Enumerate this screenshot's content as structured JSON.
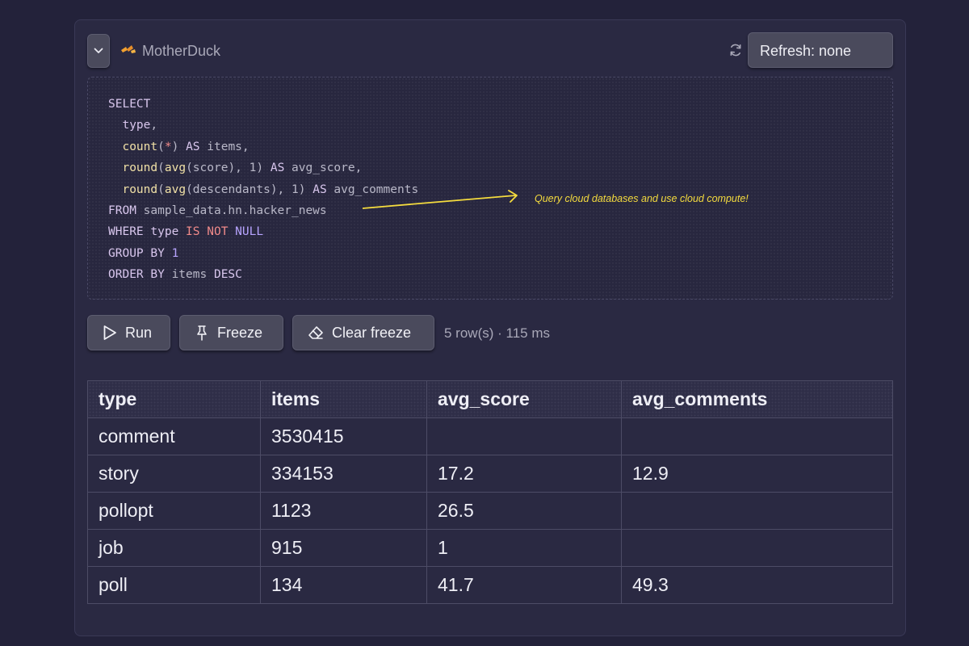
{
  "header": {
    "database_name": "MotherDuck",
    "refresh_label": "Refresh: none"
  },
  "editor": {
    "lines": [
      "SELECT",
      "  type,",
      "  count(*) AS items,",
      "  round(avg(score), 1) AS avg_score,",
      "  round(avg(descendants), 1) AS avg_comments",
      "FROM sample_data.hn.hacker_news",
      "WHERE type IS NOT NULL",
      "GROUP BY 1",
      "ORDER BY items DESC"
    ],
    "annotation": "Query cloud databases and use cloud compute!"
  },
  "actions": {
    "run_label": "Run",
    "freeze_label": "Freeze",
    "clear_freeze_label": "Clear freeze",
    "status": "5 row(s) · 115 ms"
  },
  "results": {
    "columns": [
      "type",
      "items",
      "avg_score",
      "avg_comments"
    ],
    "rows": [
      [
        "comment",
        "3530415",
        "",
        ""
      ],
      [
        "story",
        "334153",
        "17.2",
        "12.9"
      ],
      [
        "pollopt",
        "1123",
        "26.5",
        ""
      ],
      [
        "job",
        "915",
        "1",
        ""
      ],
      [
        "poll",
        "134",
        "41.7",
        "49.3"
      ]
    ]
  },
  "colors": {
    "background": "#23223a",
    "panel": "#2a2942",
    "annotation": "#f5dc3e",
    "logo": "#f0a030"
  },
  "icons": [
    "chevron-down-icon",
    "motherduck-logo",
    "refresh-icon",
    "play-icon",
    "pin-icon",
    "eraser-icon",
    "arrow-icon"
  ]
}
